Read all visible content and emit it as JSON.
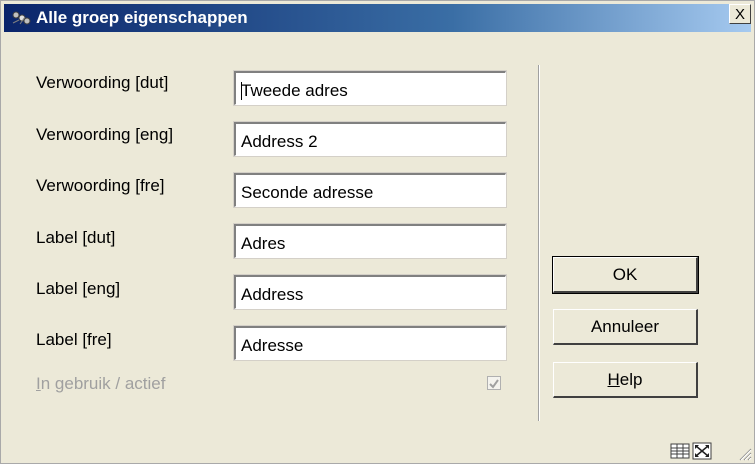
{
  "window": {
    "title": "Alle groep eigenschappen",
    "close_label": "X"
  },
  "form": {
    "fields": [
      {
        "label": "Verwoording [dut]",
        "value": "Tweede adres"
      },
      {
        "label": "Verwoording [eng]",
        "value": "Address 2"
      },
      {
        "label": "Verwoording [fre]",
        "value": "Seconde adresse"
      },
      {
        "label": "Label [dut]",
        "value": "Adres"
      },
      {
        "label": "Label [eng]",
        "value": "Address"
      },
      {
        "label": "Label [fre]",
        "value": "Adresse"
      }
    ],
    "active": {
      "label_first": "I",
      "label_rest": "n gebruik / actief",
      "checked": true,
      "enabled": false
    }
  },
  "buttons": {
    "ok_label": "OK",
    "cancel_label": "Annuleer",
    "help_first": "H",
    "help_rest": "elp"
  },
  "colors": {
    "titlebar_start": "#0a246a",
    "titlebar_end": "#a6caf0",
    "dialog_bg": "#ece9d8",
    "disabled_text": "#a0a0a0"
  },
  "icons": {
    "title": "app-icon",
    "status_left": "grid-icon",
    "status_right": "expand-icon",
    "grip": "resize-grip-icon"
  }
}
